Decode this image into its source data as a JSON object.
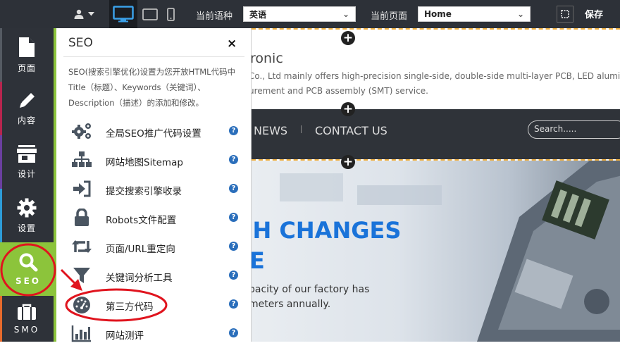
{
  "topbar": {
    "language_label": "当前语种",
    "language_value": "英语",
    "page_label": "当前页面",
    "page_value": "Home",
    "save_label": "保存"
  },
  "sidebar": {
    "items": [
      {
        "label": "页面",
        "icon": "file-icon",
        "color": "#555b63"
      },
      {
        "label": "内容",
        "icon": "pencil-icon",
        "color": "#b8254e"
      },
      {
        "label": "设计",
        "icon": "store-icon",
        "color": "#6b3fa0"
      },
      {
        "label": "设置",
        "icon": "gear-icon",
        "color": "#2d9cd8"
      },
      {
        "label": "SEO",
        "icon": "search-icon",
        "color": "#8cc43b"
      },
      {
        "label": "SMO",
        "icon": "briefcase-icon",
        "color": "#e66a2c"
      }
    ]
  },
  "panel": {
    "title": "SEO",
    "description": "SEO(搜索引擎优化)设置为您开放HTML代码中Title（标题）、Keywords（关键词）、Description（描述）的添加和修改。",
    "items": [
      {
        "label": "全局SEO推广代码设置",
        "icon": "gears-icon"
      },
      {
        "label": "网站地图Sitemap",
        "icon": "sitemap-icon"
      },
      {
        "label": "提交搜索引擎收录",
        "icon": "sign-in-icon"
      },
      {
        "label": "Robots文件配置",
        "icon": "lock-icon"
      },
      {
        "label": "页面/URL重定向",
        "icon": "retweet-icon"
      },
      {
        "label": "关键词分析工具",
        "icon": "filter-icon"
      },
      {
        "label": "第三方代码",
        "icon": "dashboard-icon"
      },
      {
        "label": "网站测评",
        "icon": "bar-chart-icon"
      }
    ]
  },
  "site": {
    "company_fragment": "ronic",
    "intro_line1": "Co., Ltd mainly offers high-precision single-side, double-side multi-layer PCB, LED aluminum P",
    "intro_line2": "urement and PCB assembly (SMT) service.",
    "nav_news": "NEWS",
    "nav_contact": "CONTACT US",
    "search_placeholder": "Search.....",
    "hero_line1": "CH CHANGES",
    "hero_line2": "E",
    "hero_text1": "pacity of our factory has",
    "hero_text2": "meters annually."
  },
  "colors": {
    "accent_green": "#8cc43b",
    "annotation_red": "#e0141e",
    "hero_blue": "#1a73d9"
  }
}
